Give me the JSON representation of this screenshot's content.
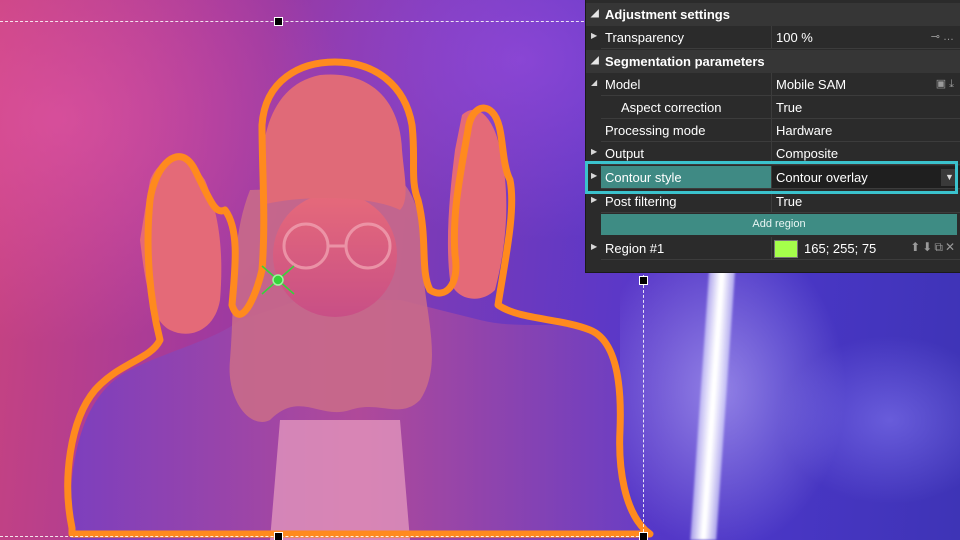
{
  "panel": {
    "adjustment_settings": {
      "title": "Adjustment settings",
      "transparency": {
        "label": "Transparency",
        "value": "100 %",
        "icons": [
          "slider-icon",
          "more-icon"
        ]
      }
    },
    "segmentation_parameters": {
      "title": "Segmentation parameters",
      "model": {
        "label": "Model",
        "value": "Mobile SAM",
        "icons": [
          "folder-icon",
          "download-icon"
        ]
      },
      "aspect_correction": {
        "label": "Aspect correction",
        "value": "True"
      },
      "processing_mode": {
        "label": "Processing mode",
        "value": "Hardware"
      },
      "output": {
        "label": "Output",
        "value": "Composite"
      },
      "contour_style": {
        "label": "Contour style",
        "value": "Contour overlay",
        "highlight_color": "#3bc2cd"
      },
      "post_filtering": {
        "label": "Post filtering",
        "value": "True"
      },
      "add_region_label": "Add region",
      "region": {
        "label": "Region #1",
        "color": "#a5ff4b",
        "value": "165; 255; 75",
        "icons": [
          "move-up-icon",
          "move-down-icon",
          "copy-icon",
          "delete-icon"
        ]
      }
    }
  },
  "canvas": {
    "contour_color": "#ff8a1e",
    "point_marker_color": "#35d43a"
  }
}
